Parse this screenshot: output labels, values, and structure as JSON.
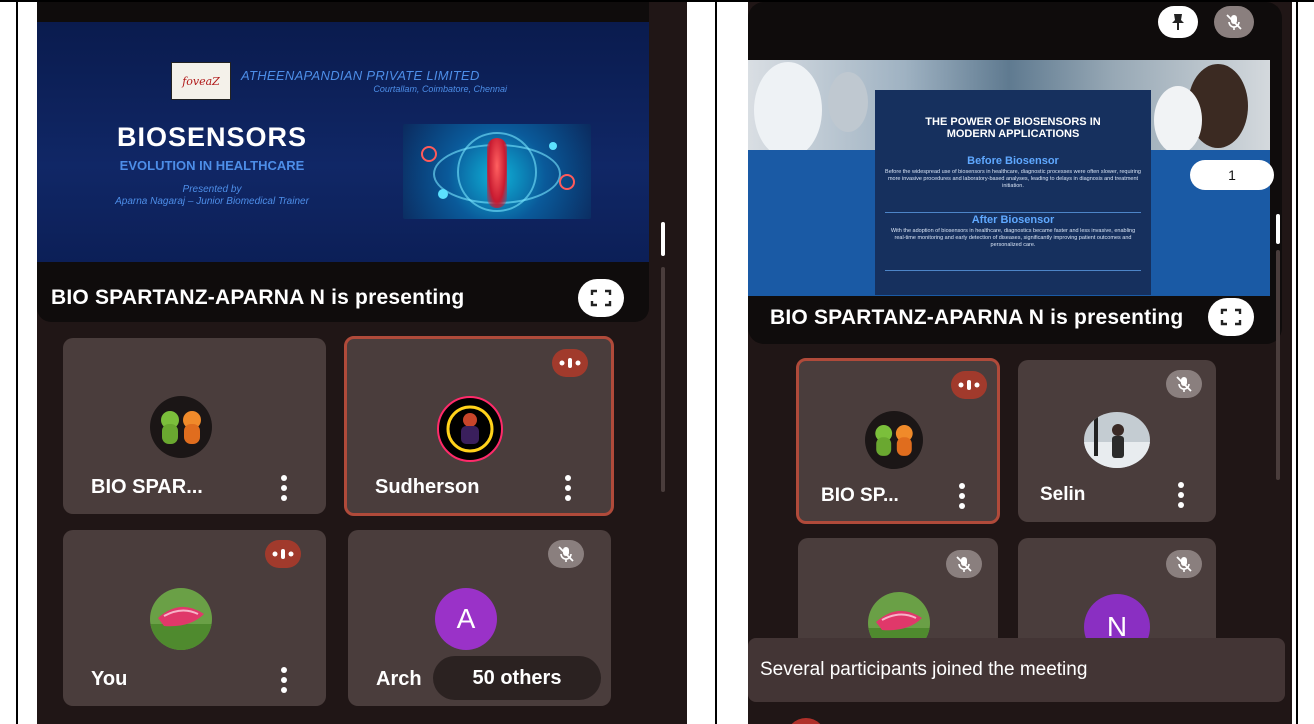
{
  "left": {
    "slide": {
      "logo_text": "foveaZ",
      "company": "ATHEENAPANDIAN PRIVATE LIMITED",
      "company_locations": "Courtallam, Coimbatore, Chennai",
      "title": "BIOSENSORS",
      "subtitle": "EVOLUTION IN HEALTHCARE",
      "presented_by": "Presented by",
      "presenter_line": "Aparna Nagaraj – Junior Biomedical Trainer"
    },
    "presenting_label": "BIO SPARTANZ-APARNA N is presenting",
    "tiles": [
      {
        "name": "BIO SPAR...",
        "state": "none"
      },
      {
        "name": "Sudherson",
        "state": "speaking"
      },
      {
        "name": "You",
        "state": "speaking"
      },
      {
        "name": "Arch",
        "avatar_letter": "A",
        "state": "muted"
      }
    ],
    "others_label": "50 others"
  },
  "right": {
    "slide": {
      "title_line1": "THE POWER OF BIOSENSORS IN",
      "title_line2": "MODERN APPLICATIONS",
      "before_heading": "Before Biosensor",
      "before_text": "Before the widespread use of biosensors in healthcare, diagnostic processes were often slower, requiring more invasive procedures and laboratory-based analyses, leading to delays in diagnosis and treatment initiation.",
      "after_heading": "After Biosensor",
      "after_text": "With the adoption of biosensors in healthcare, diagnostics became faster and less invasive, enabling real-time monitoring and early detection of diseases, significantly improving patient outcomes and personalized care."
    },
    "page_number": "1",
    "presenting_label": "BIO SPARTANZ-APARNA N is presenting",
    "tiles": [
      {
        "name": "BIO SP...",
        "state": "speaking"
      },
      {
        "name": "Selin",
        "state": "muted"
      },
      {
        "name": "",
        "state": "muted"
      },
      {
        "name": "",
        "avatar_letter": "N",
        "state": "muted"
      }
    ],
    "toast": "Several participants joined the meeting"
  },
  "colors": {
    "background": "#201616",
    "tile": "#4a3d3c",
    "speaking_border": "#b04a3a",
    "avatar_a": "#9a32c8",
    "avatar_n": "#8a2fc2"
  }
}
